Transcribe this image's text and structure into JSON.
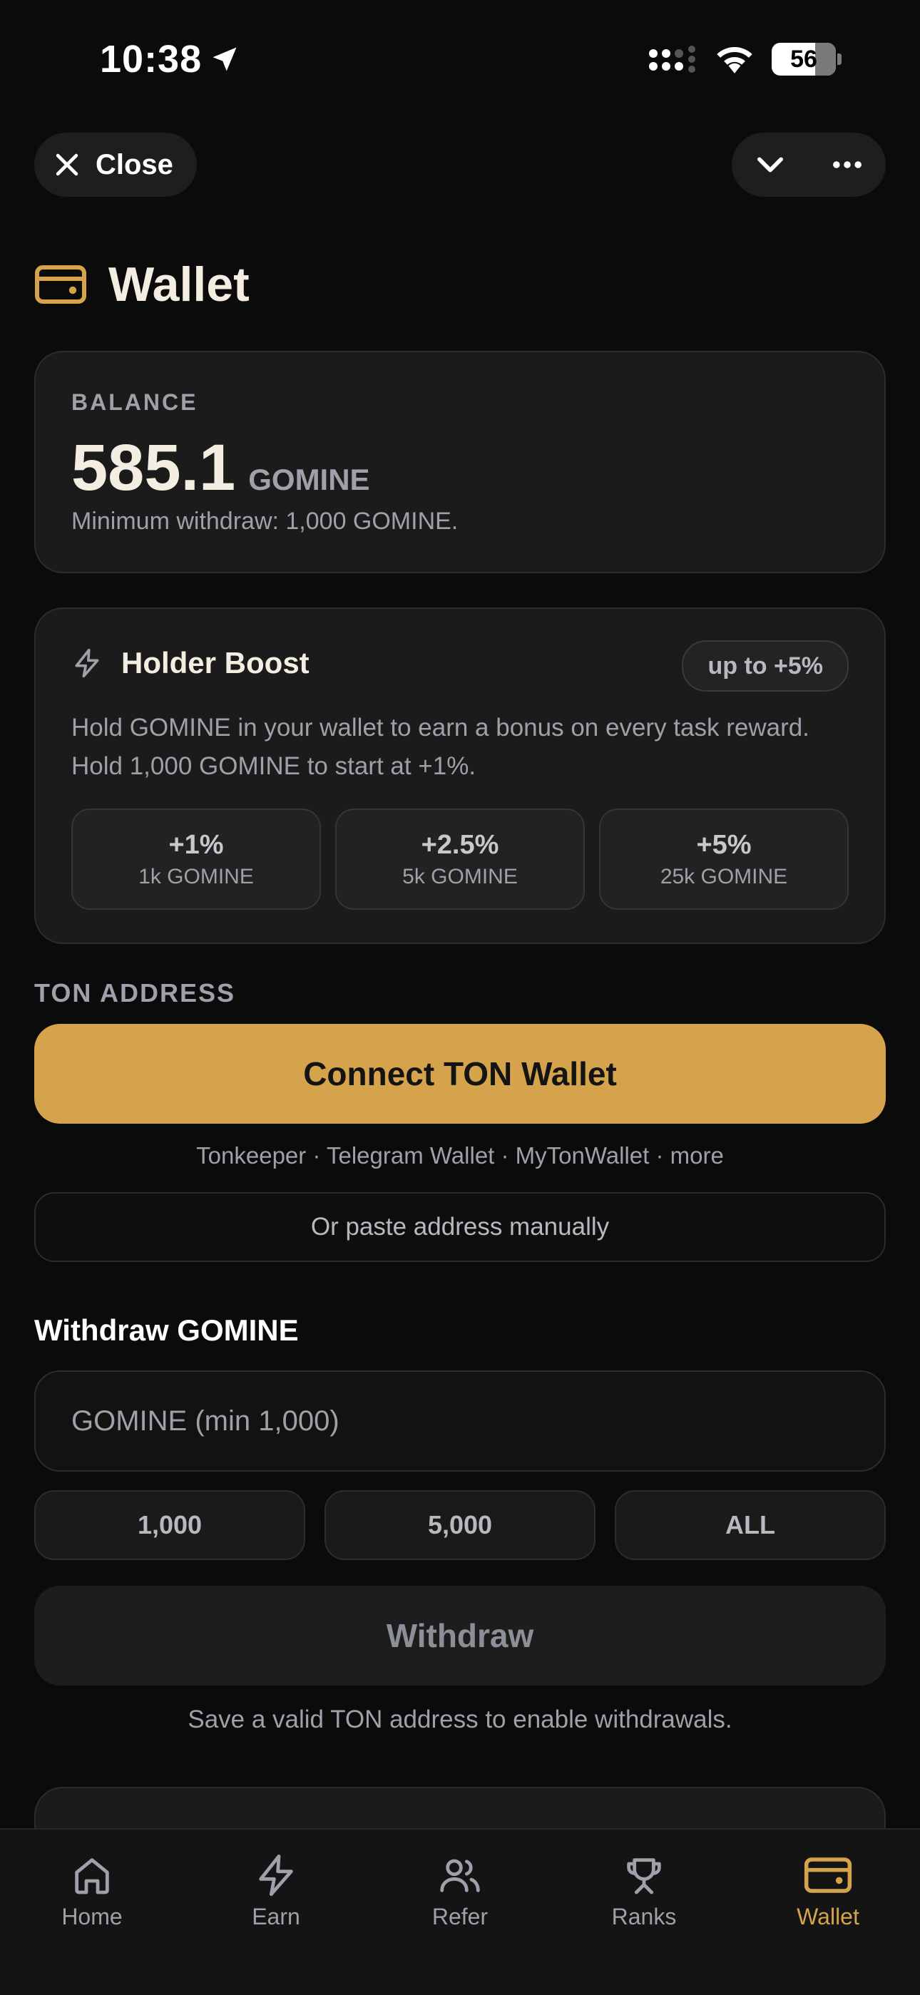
{
  "status_bar": {
    "time": "10:38",
    "battery": "56"
  },
  "top_bar": {
    "close_label": "Close"
  },
  "header": {
    "title": "Wallet"
  },
  "balance": {
    "label": "BALANCE",
    "value": "585.1",
    "unit": "GOMINE",
    "min_note": "Minimum withdraw: 1,000 GOMINE."
  },
  "boost": {
    "title": "Holder Boost",
    "badge": "up to +5%",
    "description": "Hold GOMINE in your wallet to earn a bonus on every task reward. Hold 1,000 GOMINE to start at +1%.",
    "tiers": [
      {
        "pct": "+1%",
        "req": "1k GOMINE"
      },
      {
        "pct": "+2.5%",
        "req": "5k GOMINE"
      },
      {
        "pct": "+5%",
        "req": "25k GOMINE"
      }
    ]
  },
  "ton": {
    "section_label": "TON ADDRESS",
    "connect_label": "Connect TON Wallet",
    "wallets_line": "Tonkeeper · Telegram Wallet · MyTonWallet · more",
    "paste_label": "Or paste address manually"
  },
  "withdraw": {
    "title": "Withdraw GOMINE",
    "placeholder": "GOMINE (min 1,000)",
    "quick": [
      "1,000",
      "5,000",
      "ALL"
    ],
    "button_label": "Withdraw",
    "hint": "Save a valid TON address to enable withdrawals."
  },
  "nav": {
    "items": [
      {
        "label": "Home",
        "icon": "home-icon"
      },
      {
        "label": "Earn",
        "icon": "bolt-icon"
      },
      {
        "label": "Refer",
        "icon": "users-icon"
      },
      {
        "label": "Ranks",
        "icon": "trophy-icon"
      },
      {
        "label": "Wallet",
        "icon": "wallet-icon"
      }
    ],
    "active": "Wallet"
  },
  "colors": {
    "accent": "#d4a34c",
    "background": "#0b0b0b",
    "card": "#1b1b1b",
    "muted": "#9ea0aa"
  }
}
